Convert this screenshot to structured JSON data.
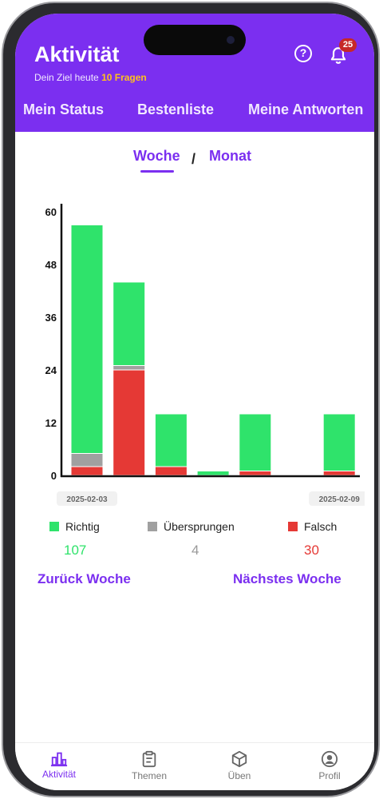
{
  "header": {
    "title": "Aktivität",
    "goal_prefix": "Dein Ziel heute",
    "goal_value": "10 Fragen",
    "notification_count": "25",
    "tabs": [
      {
        "label": "Mein Status"
      },
      {
        "label": "Bestenliste"
      },
      {
        "label": "Meine Antworten"
      }
    ]
  },
  "period_toggle": {
    "week": "Woche",
    "separator": "/",
    "month": "Monat",
    "active": "week"
  },
  "chart_data": {
    "type": "bar",
    "stacked": true,
    "categories": [
      "2025-02-03",
      "",
      "",
      "",
      "",
      "",
      "2025-02-09"
    ],
    "tick_labels": [
      "0",
      "12",
      "24",
      "36",
      "48",
      "60"
    ],
    "ylim": [
      0,
      60
    ],
    "series": [
      {
        "name": "Falsch",
        "color": "#e53935",
        "values": [
          2,
          24,
          2,
          0,
          1,
          0,
          1
        ]
      },
      {
        "name": "Übersprungen",
        "color": "#a0a0a0",
        "values": [
          3,
          1,
          0,
          0,
          0,
          0,
          0
        ]
      },
      {
        "name": "Richtig",
        "color": "#2fe36b",
        "values": [
          52,
          19,
          12,
          1,
          13,
          0,
          13
        ]
      }
    ]
  },
  "summary": {
    "richtig": {
      "label": "Richtig",
      "value": "107",
      "color": "#2fe36b"
    },
    "uebersprungen": {
      "label": "Übersprungen",
      "value": "4",
      "color": "#a0a0a0"
    },
    "falsch": {
      "label": "Falsch",
      "value": "30",
      "color": "#e53935"
    }
  },
  "week_nav": {
    "previous": "Zurück Woche",
    "next": "Nächstes Woche"
  },
  "bottom_nav": [
    {
      "label": "Aktivität",
      "icon": "chart-icon",
      "active": true
    },
    {
      "label": "Themen",
      "icon": "clipboard-icon",
      "active": false
    },
    {
      "label": "Üben",
      "icon": "cube-icon",
      "active": false
    },
    {
      "label": "Profil",
      "icon": "user-icon",
      "active": false
    }
  ],
  "colors": {
    "accent": "#7b2ff0",
    "goal_highlight": "#ffc21c",
    "badge": "#c62828"
  }
}
